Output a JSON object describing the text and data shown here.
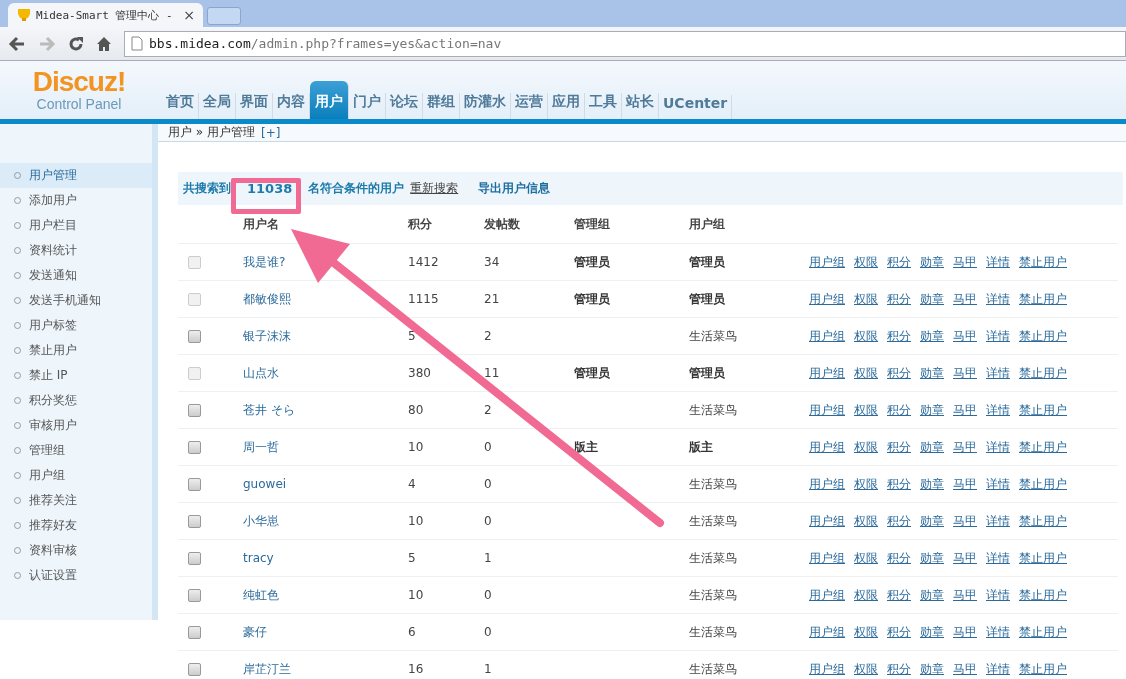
{
  "browser": {
    "tab_title": "Midea-Smart 管理中心 -",
    "tab_close": "×",
    "url_host": "bbs.midea.com",
    "url_path": "/admin.php?frames=yes&action=nav"
  },
  "logo": {
    "name": "Discuz!",
    "subtitle": "Control Panel"
  },
  "nav": [
    {
      "label": "首页",
      "selected": false
    },
    {
      "label": "全局",
      "selected": false
    },
    {
      "label": "界面",
      "selected": false
    },
    {
      "label": "内容",
      "selected": false
    },
    {
      "label": "用户",
      "selected": true
    },
    {
      "label": "门户",
      "selected": false
    },
    {
      "label": "论坛",
      "selected": false
    },
    {
      "label": "群组",
      "selected": false
    },
    {
      "label": "防灌水",
      "selected": false
    },
    {
      "label": "运营",
      "selected": false
    },
    {
      "label": "应用",
      "selected": false
    },
    {
      "label": "工具",
      "selected": false
    },
    {
      "label": "站长",
      "selected": false
    },
    {
      "label": "UCenter",
      "selected": false
    }
  ],
  "breadcrumb": {
    "parts": [
      "用户",
      "»",
      "用户管理"
    ],
    "add": "[+]"
  },
  "sidebar": [
    {
      "label": "用户管理",
      "selected": true
    },
    {
      "label": "添加用户",
      "selected": false
    },
    {
      "label": "用户栏目",
      "selected": false
    },
    {
      "label": "资料统计",
      "selected": false
    },
    {
      "label": "发送通知",
      "selected": false
    },
    {
      "label": "发送手机通知",
      "selected": false
    },
    {
      "label": "用户标签",
      "selected": false
    },
    {
      "label": "禁止用户",
      "selected": false
    },
    {
      "label": "禁止 IP",
      "selected": false
    },
    {
      "label": "积分奖惩",
      "selected": false
    },
    {
      "label": "审核用户",
      "selected": false
    },
    {
      "label": "管理组",
      "selected": false
    },
    {
      "label": "用户组",
      "selected": false
    },
    {
      "label": "推荐关注",
      "selected": false
    },
    {
      "label": "推荐好友",
      "selected": false
    },
    {
      "label": "资料审核",
      "selected": false
    },
    {
      "label": "认证设置",
      "selected": false
    }
  ],
  "summary": {
    "prefix": "共搜索到",
    "count": "11038",
    "suffix": "名符合条件的用户",
    "research": "重新搜索",
    "export": "导出用户信息"
  },
  "table": {
    "columns": [
      "用户名",
      "积分",
      "发帖数",
      "管理组",
      "用户组"
    ],
    "rows": [
      {
        "name": "我是谁?",
        "points": "1412",
        "posts": "34",
        "admin_group": "管理员",
        "user_group": "管理员",
        "staff": true,
        "disabled": true,
        "actions": [
          "用户组",
          "权限",
          "积分",
          "勋章",
          "马甲",
          "详情",
          "禁止用户"
        ]
      },
      {
        "name": "都敏俊熙",
        "points": "1115",
        "posts": "21",
        "admin_group": "管理员",
        "user_group": "管理员",
        "staff": true,
        "disabled": true,
        "actions": [
          "用户组",
          "权限",
          "积分",
          "勋章",
          "马甲",
          "详情",
          "禁止用户"
        ]
      },
      {
        "name": "银子沫沫",
        "points": "5",
        "posts": "2",
        "user_group": "生活菜鸟",
        "staff": false,
        "disabled": false,
        "actions": [
          "用户组",
          "权限",
          "积分",
          "勋章",
          "马甲",
          "详情",
          "禁止用户"
        ]
      },
      {
        "name": "山点水",
        "points": "380",
        "posts": "11",
        "admin_group": "管理员",
        "user_group": "管理员",
        "staff": true,
        "disabled": true,
        "actions": [
          "用户组",
          "权限",
          "积分",
          "勋章",
          "马甲",
          "详情",
          "禁止用户"
        ]
      },
      {
        "name": "苍井 そら",
        "points": "80",
        "posts": "2",
        "user_group": "生活菜鸟",
        "staff": false,
        "disabled": false,
        "actions": [
          "用户组",
          "权限",
          "积分",
          "勋章",
          "马甲",
          "详情",
          "禁止用户"
        ]
      },
      {
        "name": "周一哲",
        "points": "10",
        "posts": "0",
        "admin_group": "版主",
        "user_group": "版主",
        "staff": true,
        "disabled": false,
        "actions": [
          "用户组",
          "权限",
          "积分",
          "勋章",
          "马甲",
          "详情",
          "禁止用户"
        ]
      },
      {
        "name": "guowei",
        "points": "4",
        "posts": "0",
        "user_group": "生活菜鸟",
        "staff": false,
        "disabled": false,
        "actions": [
          "用户组",
          "权限",
          "积分",
          "勋章",
          "马甲",
          "详情",
          "禁止用户"
        ]
      },
      {
        "name": "小华崽",
        "points": "10",
        "posts": "0",
        "user_group": "生活菜鸟",
        "staff": false,
        "disabled": false,
        "actions": [
          "用户组",
          "权限",
          "积分",
          "勋章",
          "马甲",
          "详情",
          "禁止用户"
        ]
      },
      {
        "name": "tracy",
        "points": "5",
        "posts": "1",
        "user_group": "生活菜鸟",
        "staff": false,
        "disabled": false,
        "actions": [
          "用户组",
          "权限",
          "积分",
          "勋章",
          "马甲",
          "详情",
          "禁止用户"
        ]
      },
      {
        "name": "纯虹色",
        "points": "10",
        "posts": "0",
        "user_group": "生活菜鸟",
        "staff": false,
        "disabled": false,
        "actions": [
          "用户组",
          "权限",
          "积分",
          "勋章",
          "马甲",
          "详情",
          "禁止用户"
        ]
      },
      {
        "name": "豪仔",
        "points": "6",
        "posts": "0",
        "user_group": "生活菜鸟",
        "staff": false,
        "disabled": false,
        "actions": [
          "用户组",
          "权限",
          "积分",
          "勋章",
          "马甲",
          "详情",
          "禁止用户"
        ]
      },
      {
        "name": "岸芷汀兰",
        "points": "16",
        "posts": "1",
        "user_group": "生活菜鸟",
        "staff": false,
        "disabled": false,
        "actions": [
          "用户组",
          "权限",
          "积分",
          "勋章",
          "马甲",
          "详情",
          "禁止用户"
        ]
      }
    ]
  }
}
